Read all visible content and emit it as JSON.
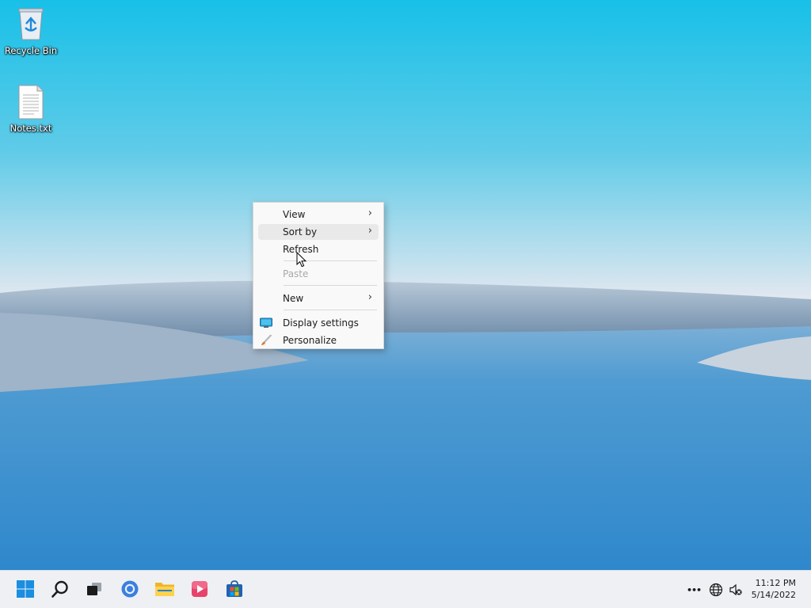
{
  "desktop": {
    "icons": [
      {
        "label": "Recycle Bin",
        "icon": "recycle-bin-icon"
      },
      {
        "label": "Notes.txt",
        "icon": "text-file-icon"
      }
    ]
  },
  "context_menu": {
    "items": [
      {
        "label": "View",
        "has_submenu": true
      },
      {
        "label": "Sort by",
        "has_submenu": true,
        "highlighted": true
      },
      {
        "label": "Refresh"
      },
      {
        "label": "Paste",
        "disabled": true
      },
      {
        "label": "New",
        "has_submenu": true
      },
      {
        "label": "Display settings",
        "icon": "display-icon"
      },
      {
        "label": "Personalize",
        "icon": "paintbrush-icon"
      }
    ],
    "submenu_arrow": "›"
  },
  "taskbar": {
    "apps": [
      {
        "name": "start-button",
        "icon": "windows-logo-icon"
      },
      {
        "name": "search-button",
        "icon": "search-icon"
      },
      {
        "name": "task-view-button",
        "icon": "task-view-icon"
      },
      {
        "name": "browser-button",
        "icon": "browser-icon"
      },
      {
        "name": "file-explorer-button",
        "icon": "folder-icon"
      },
      {
        "name": "media-player-button",
        "icon": "media-player-icon"
      },
      {
        "name": "store-button",
        "icon": "store-icon"
      }
    ],
    "tray": {
      "overflow_glyph": "•••",
      "network_icon": "globe-icon",
      "volume_icon": "speaker-muted-icon"
    },
    "clock": {
      "time": "11:12 PM",
      "date": "5/14/2022"
    }
  },
  "colors": {
    "accent": "#0078d4",
    "menu_bg": "#f9f9f9",
    "taskbar_bg": "#eef0f4"
  }
}
